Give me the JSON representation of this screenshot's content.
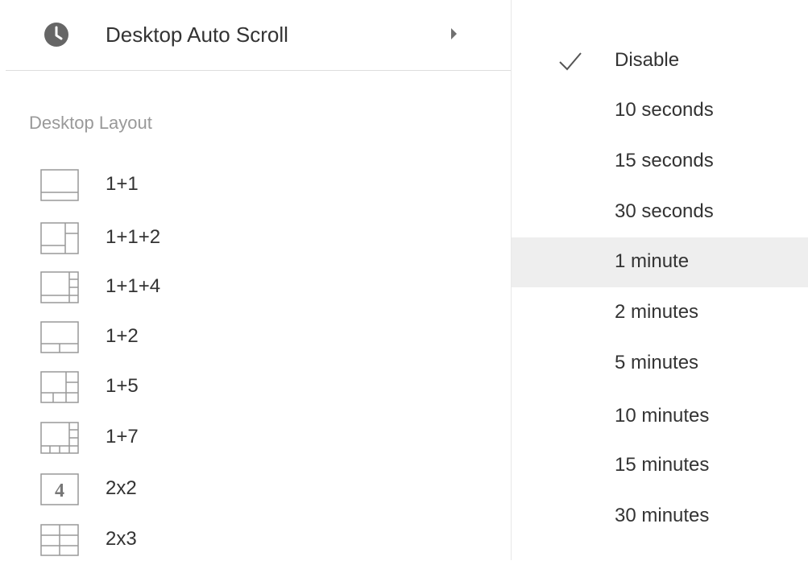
{
  "left_menu": {
    "auto_scroll": {
      "label": "Desktop Auto Scroll",
      "icon": "clock-icon",
      "submenu_indicator_icon": "chevron-right-icon"
    },
    "section_heading": "Desktop Layout",
    "layouts": [
      {
        "label": "1+1",
        "icon": "layout-1-1-icon"
      },
      {
        "label": "1+1+2",
        "icon": "layout-1-1-2-icon"
      },
      {
        "label": "1+1+4",
        "icon": "layout-1-1-4-icon"
      },
      {
        "label": "1+2",
        "icon": "layout-1-2-icon"
      },
      {
        "label": "1+5",
        "icon": "layout-1-5-icon"
      },
      {
        "label": "1+7",
        "icon": "layout-1-7-icon"
      },
      {
        "label": "2x2",
        "icon": "layout-2x2-icon",
        "icon_text": "4"
      },
      {
        "label": "2x3",
        "icon": "layout-2x3-icon"
      }
    ]
  },
  "auto_scroll_submenu": {
    "selected": "Disable",
    "highlighted": "1 minute",
    "options": [
      {
        "label": "Disable",
        "checked": true
      },
      {
        "label": "10 seconds"
      },
      {
        "label": "15 seconds"
      },
      {
        "label": "30 seconds"
      },
      {
        "label": "1 minute"
      },
      {
        "label": "2 minutes"
      },
      {
        "label": "5 minutes"
      },
      {
        "label": "10 minutes"
      },
      {
        "label": "15 minutes"
      },
      {
        "label": "30 minutes"
      }
    ]
  },
  "colors": {
    "text": "#333333",
    "muted_text": "#999999",
    "icon": "#666666",
    "highlight": "#eeeeee",
    "divider": "#dddddd",
    "layout_icon": "#999999"
  }
}
